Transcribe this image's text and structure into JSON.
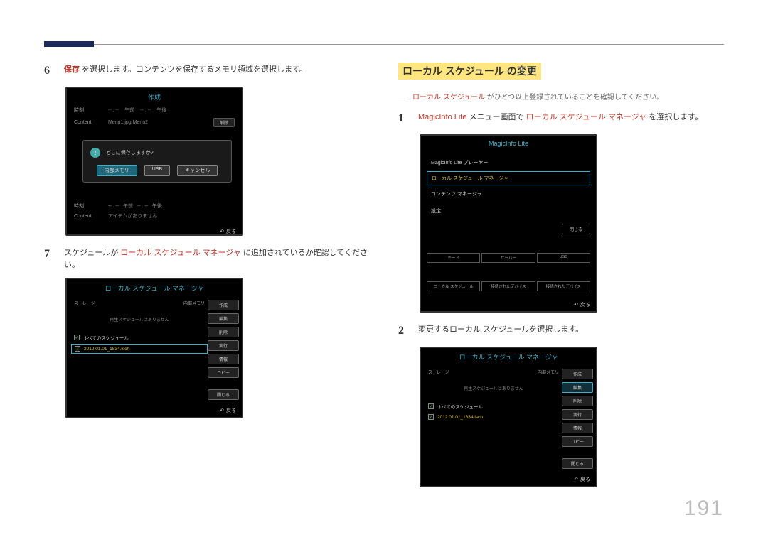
{
  "page_number": "191",
  "left": {
    "step6": {
      "num": "6",
      "kw": "保存",
      "text": " を選択します。コンテンツを保存するメモリ領域を選択します。"
    },
    "step7": {
      "num": "7",
      "pre": "スケジュールが ",
      "kw": "ローカル スケジュール マネージャ",
      "post": " に追加されているか確認してください。"
    }
  },
  "create_panel": {
    "title": "作成",
    "time_label": "時刻",
    "am": "午前",
    "pm": "午後",
    "content_label": "Content",
    "content_value": "Menu1.jpg,Menu2",
    "del_btn": "削除",
    "modal_q": "どこに保存しますか?",
    "modal_btn1": "内部メモリ",
    "modal_btn2": "USB",
    "modal_cancel": "キャンセル",
    "back": "戻る",
    "faded_content": "アイテムがありません"
  },
  "sm_panel": {
    "title": "ローカル スケジュール マネージャ",
    "storage": "ストレージ",
    "internal": "内部メモリ",
    "no_sched": "再生スケジュールはありません",
    "all_sched": "すべてのスケジュール",
    "item": "2012.01.01_1834.lsch",
    "btns": {
      "create": "作成",
      "edit": "編集",
      "delete": "削除",
      "run": "実行",
      "info": "情報",
      "copy": "コピー",
      "close": "閉じる"
    },
    "back": "戻る"
  },
  "right": {
    "header": "ローカル スケジュール の変更",
    "note_kw": "ローカル スケジュール",
    "note": " がひとつ以上登録されていることを確認してください。",
    "step1": {
      "num": "1",
      "kw1": "MagicInfo Lite",
      "mid": " メニュー画面で ",
      "kw2": "ローカル スケジュール マネージャ",
      "post": " を選択します。"
    },
    "step2": {
      "num": "2",
      "text": "変更するローカル スケジュールを選択します。"
    }
  },
  "mi_panel": {
    "title": "MagicInfo Lite",
    "items": {
      "player": "MagicInfo Lite プレーヤー",
      "sched": "ローカル スケジュール マネージャ",
      "content": "コンテンツ マネージャ",
      "settings": "設定"
    },
    "close": "閉じる",
    "bottom": {
      "mode": "モード",
      "server": "サーバー",
      "usb": "USB",
      "r1": "ローカル スケジュール",
      "r2": "接続されたデバイス",
      "r3": "接続されたデバイス"
    },
    "back": "戻る"
  },
  "sm_panel2": {
    "title": "ローカル スケジュール マネージャ",
    "storage": "ストレージ",
    "internal": "内部メモリ",
    "no_sched": "再生スケジュールはありません",
    "all_sched": "すべてのスケジュール",
    "item": "2012.01.01_1834.lsch",
    "btns": {
      "create": "作成",
      "edit": "編集",
      "delete": "削除",
      "run": "実行",
      "info": "情報",
      "copy": "コピー",
      "close": "閉じる"
    },
    "back": "戻る"
  }
}
